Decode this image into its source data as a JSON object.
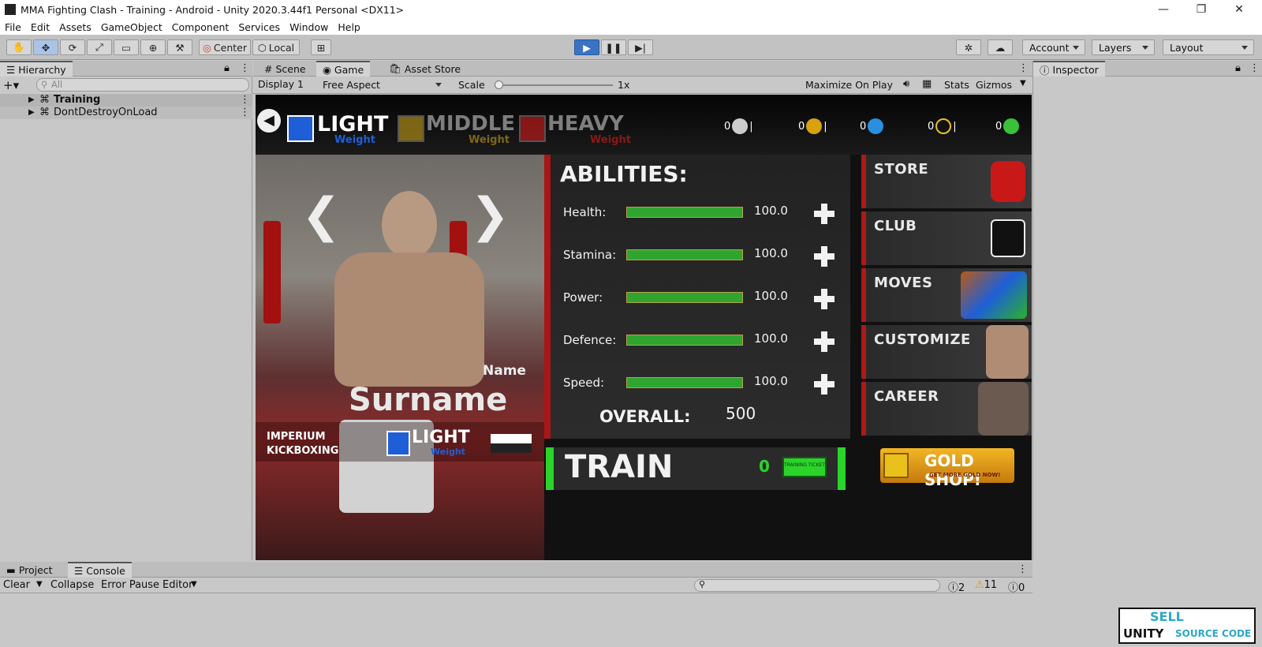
{
  "window": {
    "title": "MMA Fighting Clash - Training - Android - Unity 2020.3.44f1 Personal <DX11>"
  },
  "menu": [
    "File",
    "Edit",
    "Assets",
    "GameObject",
    "Component",
    "Services",
    "Window",
    "Help"
  ],
  "toolbar": {
    "center": "Center",
    "local": "Local",
    "account": "Account",
    "layers": "Layers",
    "layout": "Layout"
  },
  "hierarchy": {
    "tab": "Hierarchy",
    "search_placeholder": "All",
    "items": [
      "Training",
      "DontDestroyOnLoad"
    ]
  },
  "scene_tabs": {
    "scene": "Scene",
    "game": "Game",
    "asset_store": "Asset Store"
  },
  "game_toolbar": {
    "display": "Display 1",
    "aspect": "Free Aspect",
    "scale_label": "Scale",
    "scale_value": "1x",
    "maximize": "Maximize On Play",
    "stats": "Stats",
    "gizmos": "Gizmos"
  },
  "inspector": {
    "tab": "Inspector"
  },
  "game": {
    "weights": [
      {
        "big": "LIGHT",
        "small": "Weight",
        "color": "#1e5fd8"
      },
      {
        "big": "MIDDLE",
        "small": "Weight",
        "color": "#b89418"
      },
      {
        "big": "HEAVY",
        "small": "Weight",
        "color": "#c81c1c"
      }
    ],
    "currencies": [
      "0",
      "0",
      "0",
      "0",
      "0"
    ],
    "abilities_title": "ABILITIES:",
    "abilities": [
      {
        "label": "Health:",
        "value": "100.0",
        "fill": 1.0
      },
      {
        "label": "Stamina:",
        "value": "100.0",
        "fill": 1.0
      },
      {
        "label": "Power:",
        "value": "100.0",
        "fill": 1.0
      },
      {
        "label": "Defence:",
        "value": "100.0",
        "fill": 1.0
      },
      {
        "label": "Speed:",
        "value": "100.0",
        "fill": 1.0
      }
    ],
    "overall_label": "OVERALL:",
    "overall_value": "500",
    "fighter": {
      "name": "Name",
      "surname": "Surname",
      "club_line1": "IMPERIUM",
      "club_line2": "KICKBOXING",
      "weight_big": "LIGHT",
      "weight_small": "Weight"
    },
    "menu": [
      "STORE",
      "CLUB",
      "MOVES",
      "CUSTOMIZE",
      "CAREER"
    ],
    "train": {
      "label": "TRAIN",
      "count": "0",
      "ticket": "TRAINING TICKET"
    },
    "gold_shop": {
      "title": "GOLD SHOP!",
      "sub": "GET MORE GOLD NOW!"
    }
  },
  "bottom": {
    "project_tab": "Project",
    "console_tab": "Console",
    "clear": "Clear",
    "collapse": "Collapse",
    "error_pause": "Error Pause",
    "editor": "Editor",
    "count_info": "2",
    "count_warn": "11",
    "count_err": "0"
  },
  "watermark": {
    "line1": "SELL",
    "line2": "UNITY",
    "line3": "SOURCE CODE"
  }
}
